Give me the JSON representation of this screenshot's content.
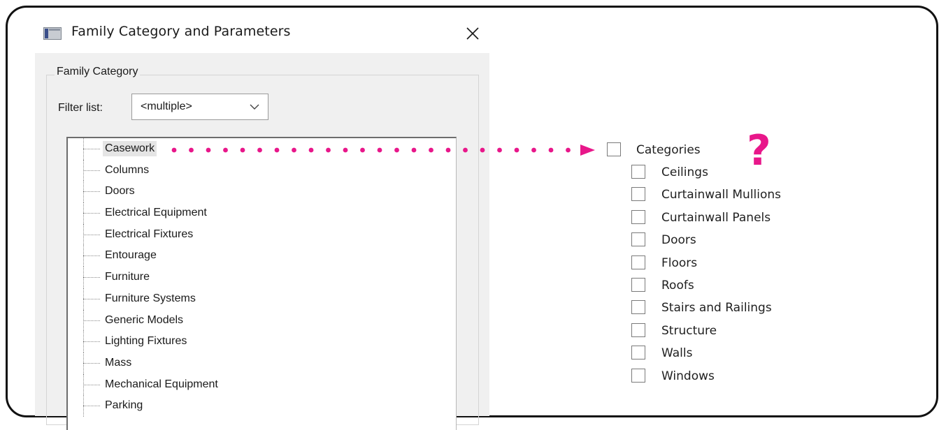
{
  "dialog": {
    "title": "Family Category and Parameters",
    "group_title": "Family Category",
    "filter_label": "Filter list:",
    "filter_value": "<multiple>",
    "tree_items": [
      "Casework",
      "Columns",
      "Doors",
      "Electrical Equipment",
      "Electrical Fixtures",
      "Entourage",
      "Furniture",
      "Furniture Systems",
      "Generic Models",
      "Lighting Fixtures",
      "Mass",
      "Mechanical Equipment",
      "Parking"
    ],
    "selected_item": "Casework"
  },
  "annotation": {
    "question_mark": "?",
    "accent_color": "#e8178a"
  },
  "categories": {
    "header": "Categories",
    "items": [
      "Ceilings",
      "Curtainwall Mullions",
      "Curtainwall Panels",
      "Doors",
      "Floors",
      "Roofs",
      "Stairs and Railings",
      "Structure",
      "Walls",
      "Windows"
    ]
  },
  "icons": {
    "app": "revit-app-icon",
    "close": "close-icon",
    "dropdown": "chevron-down-icon",
    "arrow": "arrow-right-icon"
  }
}
